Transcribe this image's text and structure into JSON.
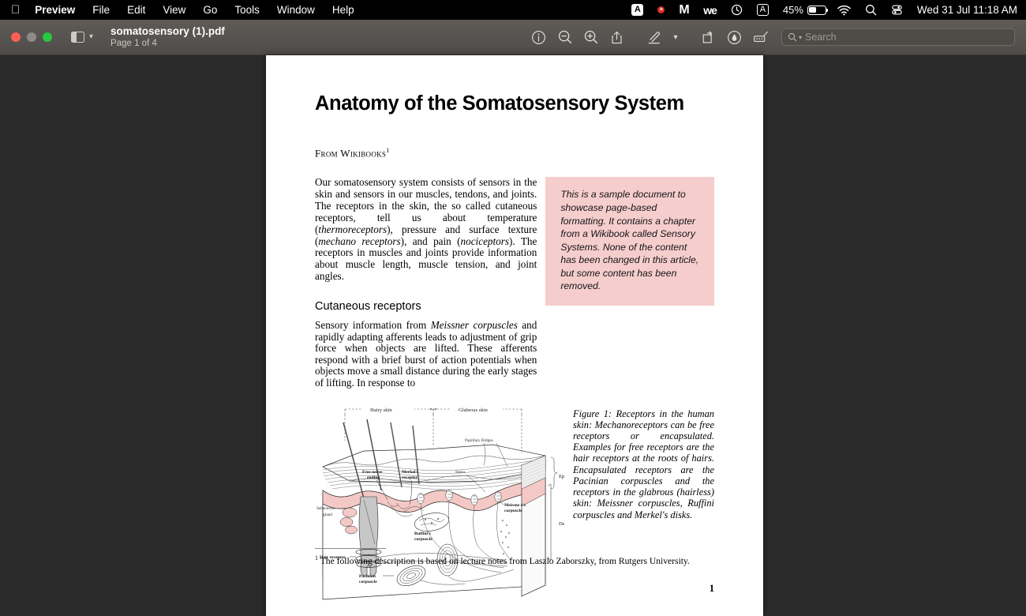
{
  "menubar": {
    "apple_icon": "apple-icon",
    "items": [
      {
        "label": "Preview",
        "bold": true
      },
      {
        "label": "File",
        "bold": false
      },
      {
        "label": "Edit",
        "bold": false
      },
      {
        "label": "View",
        "bold": false
      },
      {
        "label": "Go",
        "bold": false
      },
      {
        "label": "Tools",
        "bold": false
      },
      {
        "label": "Window",
        "bold": false
      },
      {
        "label": "Help",
        "bold": false
      }
    ],
    "tray": {
      "app_icon_a": "A",
      "badge_icon": "×",
      "malware_icon": "M",
      "we_icon": "we",
      "clock_icon": "clock-icon",
      "input_source": "A",
      "battery_percent": "45%",
      "battery_level": 45,
      "wifi_icon": "wifi-icon",
      "spotlight_icon": "search-icon",
      "control_center_icon": "control-center-icon",
      "datetime": "Wed 31 Jul  11:18 AM"
    }
  },
  "toolbar": {
    "window_title": "somatosensory (1).pdf",
    "page_status": "Page 1 of 4",
    "sidebar_icon": "sidebar-icon",
    "sidebar_chevron": "chevron-down-icon",
    "buttons": [
      {
        "name": "info-icon"
      },
      {
        "name": "zoom-out-icon"
      },
      {
        "name": "zoom-in-icon"
      },
      {
        "name": "share-icon"
      },
      {
        "name": "markup-pen-icon"
      },
      {
        "name": "chevron-down-icon"
      },
      {
        "name": "rotate-icon"
      },
      {
        "name": "annotate-icon"
      },
      {
        "name": "highlight-icon"
      }
    ],
    "search": {
      "placeholder": "Search",
      "icon": "search-icon",
      "chevron": "chevron-down-icon",
      "value": ""
    }
  },
  "document": {
    "title": "Anatomy of the Somatosensory System",
    "from_line": "From Wikibooks",
    "from_superscript": "1",
    "selected_paragraph": {
      "part1": "Our somatosensory system consists of sensors in the skin and sensors in our muscles, tendons, and joints. The receptors in the skin, the so called cutaneous receptors, tell us about temperature (",
      "italic1": "thermoreceptors",
      "part2": "), pressure and surface texture (",
      "italic2": "mechano receptors",
      "part3": "), and pain (",
      "italic3": "nociceptors",
      "part4": "). The receptors in muscles and joints provide information about muscle length, muscle tension, and joint angles.",
      "highlight_color": "#b3d4fb"
    },
    "callout": {
      "text": "This is a sample document to showcase page-based formatting. It contains a chapter from a Wikibook called Sensory Systems. None of the content has been changed in this article, but some content has been removed.",
      "background_color": "#f6cdcd"
    },
    "section_heading": "Cutaneous receptors",
    "section_paragraph": {
      "part1": "Sensory information from ",
      "italic1": "Meissner corpuscles",
      "part2": " and rapidly adapting afferents leads to adjustment of grip force when objects are lifted. These afferents respond with a brief burst of action potentials when objects move a small distance during the early stages of lifting. In response to"
    },
    "figure": {
      "caption": "Figure 1:  Receptors in the human skin: Mechanoreceptors can be free receptors or encapsulated. Examples for free receptors are the hair receptors at the roots of hairs. Encapsulated receptors are the Pacinian corpuscles and the receptors in the glabrous (hairless) skin: Meissner corpuscles, Ruffini corpuscles and Merkel's disks.",
      "labels": {
        "hairy_skin": "Hairy skin",
        "glabrous_skin": "Glabrous skin",
        "papillary_ridges": "Papillary Ridges",
        "epidermis": "Epidermis",
        "dermis": "Dermis",
        "free_nerve_ending_1": "Free nerve",
        "free_nerve_ending_2": "ending",
        "merkel_1": "Merkel's",
        "merkel_2": "receptor",
        "septa": "Septa",
        "sebaceous_1": "Sebaceous",
        "sebaceous_2": "gland",
        "hair_receptor": "Hair receptor",
        "ruffini_1": "Ruffini's",
        "ruffini_2": "corpuscle",
        "pacinian_1": "Pacinian",
        "pacinian_2": "corpuscle",
        "meissner_1": "Meissne r's",
        "meissner_2": "corpuscle"
      },
      "skin_color": "#f4c8c5"
    },
    "footnote": {
      "marker": "1",
      "text": "The following description is based on lecture notes from Laszlo Zaborszky, from Rutgers University."
    },
    "page_number": "1"
  }
}
